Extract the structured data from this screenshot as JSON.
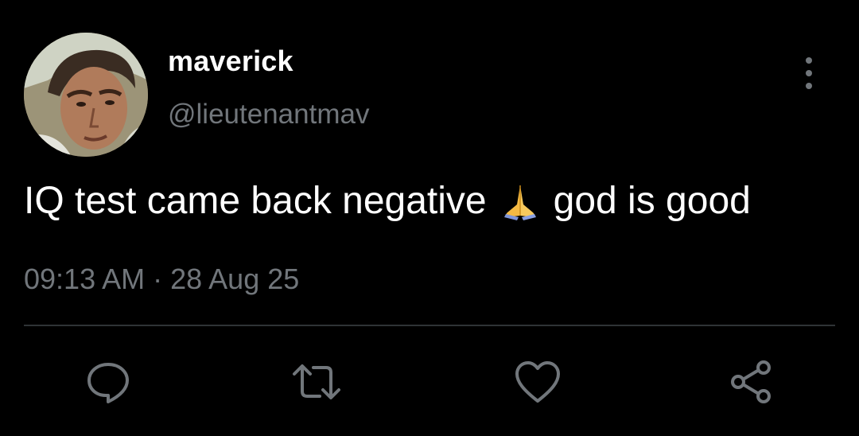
{
  "user": {
    "display_name": "maverick",
    "handle": "@lieutenantmav",
    "avatar_icon": "profile-photo"
  },
  "tweet": {
    "text_before": "IQ test came back negative",
    "emoji": "folded-hands-emoji",
    "text_after": "god is good",
    "timestamp": "09:13 AM · 28 Aug 25"
  },
  "actions": {
    "icons": [
      "reply-icon",
      "retweet-icon",
      "like-icon",
      "share-icon"
    ]
  },
  "colors": {
    "background": "#000000",
    "primary_text": "#ffffff",
    "secondary_text": "#71767b",
    "divider": "#2f3336"
  }
}
